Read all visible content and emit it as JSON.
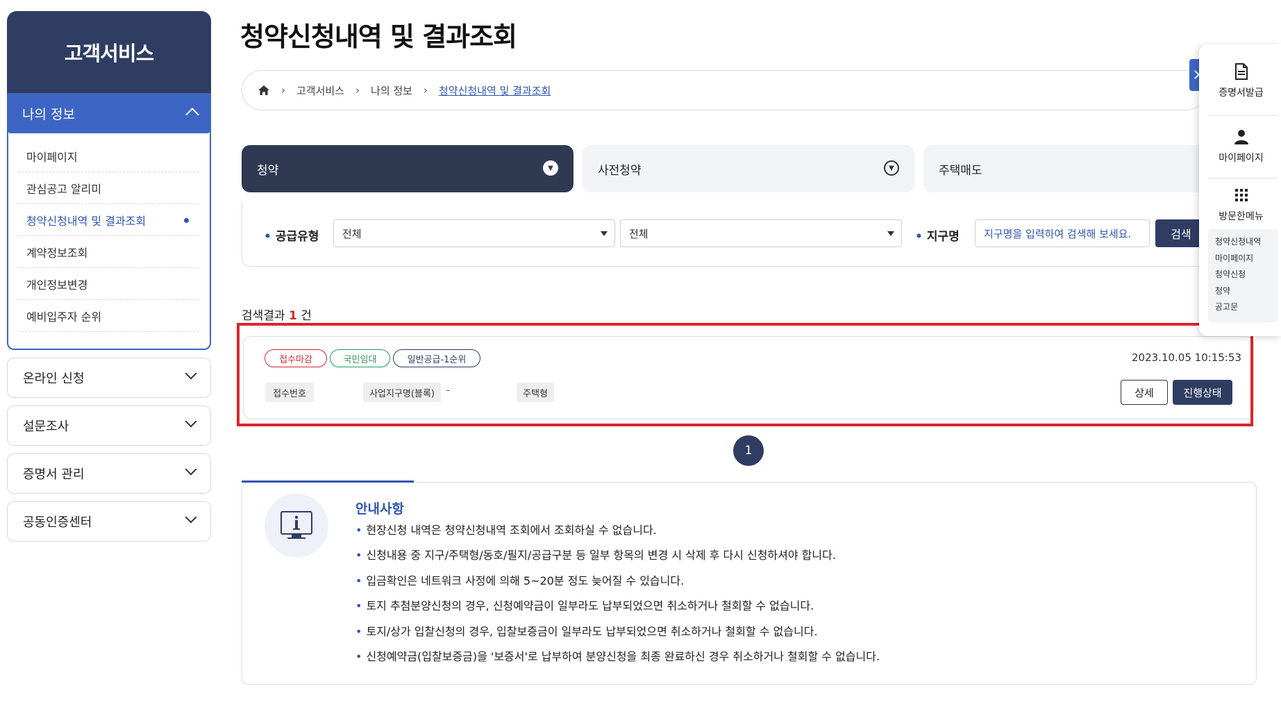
{
  "sidebar": {
    "title": "고객서비스",
    "active_group": "나의 정보",
    "sub_items": [
      {
        "label": "마이페이지"
      },
      {
        "label": "관심공고 알리미"
      },
      {
        "label": "청약신청내역 및 결과조회",
        "selected": true
      },
      {
        "label": "계약정보조회"
      },
      {
        "label": "개인정보변경"
      },
      {
        "label": "예비입주자 순위"
      }
    ],
    "groups": [
      {
        "label": "온라인 신청"
      },
      {
        "label": "설문조사"
      },
      {
        "label": "증명서 관리"
      },
      {
        "label": "공동인증센터"
      }
    ]
  },
  "page": {
    "title": "청약신청내역 및 결과조회"
  },
  "breadcrumb": {
    "items": [
      "고객서비스",
      "나의 정보"
    ],
    "current": "청약신청내역 및 결과조회"
  },
  "tabs": [
    {
      "label": "청약",
      "active": true
    },
    {
      "label": "사전청약",
      "active": false
    },
    {
      "label": "주택매도",
      "active": false
    }
  ],
  "filter": {
    "supply_label": "공급유형",
    "select1_value": "전체",
    "select2_value": "전체",
    "district_label": "지구명",
    "district_placeholder": "지구명을 입력하여 검색해 보세요.",
    "search_label": "검색"
  },
  "results": {
    "count_prefix": "검색결과",
    "count": "1",
    "count_suffix": "건",
    "items": [
      {
        "badges": [
          "접수마감",
          "국민임대",
          "일반공급-1순위"
        ],
        "datetime": "2023.10.05 10:15:53",
        "receipt_label": "접수번호",
        "receipt_value": "",
        "project_label": "사업지구명(블록)",
        "project_value": "-",
        "type_label": "주택형",
        "type_value": "",
        "detail_label": "상세",
        "status_label": "진행상태"
      }
    ]
  },
  "pagination": {
    "current": "1"
  },
  "notice": {
    "title": "안내사항",
    "items": [
      "현장신청 내역은 청약신청내역 조회에서 조회하실 수 없습니다.",
      "신청내용 중 지구/주택형/동호/필지/공급구분 등 일부 항목의 변경 시 삭제 후 다시 신청하셔야 합니다.",
      "입금확인은 네트워크 사정에 의해 5~20분 정도 늦어질 수 있습니다.",
      "토지 추첨분양신청의 경우, 신청예약금이 일부라도 납부되었으면 취소하거나 철회할 수 없습니다.",
      "토지/상가 입찰신청의 경우, 입찰보증금이 일부라도 납부되었으면 취소하거나 철회할 수 없습니다.",
      "신청예약금(입찰보증금)을 '보증서'로 납부하여 분양신청을 최종 완료하신 경우 취소하거나 철회할 수 없습니다."
    ]
  },
  "quick_panel": {
    "items": [
      {
        "label": "증명서발급",
        "icon": "document-icon"
      },
      {
        "label": "마이페이지",
        "icon": "person-icon"
      },
      {
        "label": "방문한메뉴",
        "icon": "grid-icon"
      }
    ],
    "recent": [
      "청약신청내역",
      "마이페이지",
      "청약신청",
      "청약",
      "공고문"
    ]
  },
  "colors": {
    "navy": "#2f3d63",
    "accent_blue": "#3d66c4",
    "link_blue": "#2d55b3",
    "highlight_red": "#d9262e",
    "badge_green": "#2a9a5a"
  }
}
